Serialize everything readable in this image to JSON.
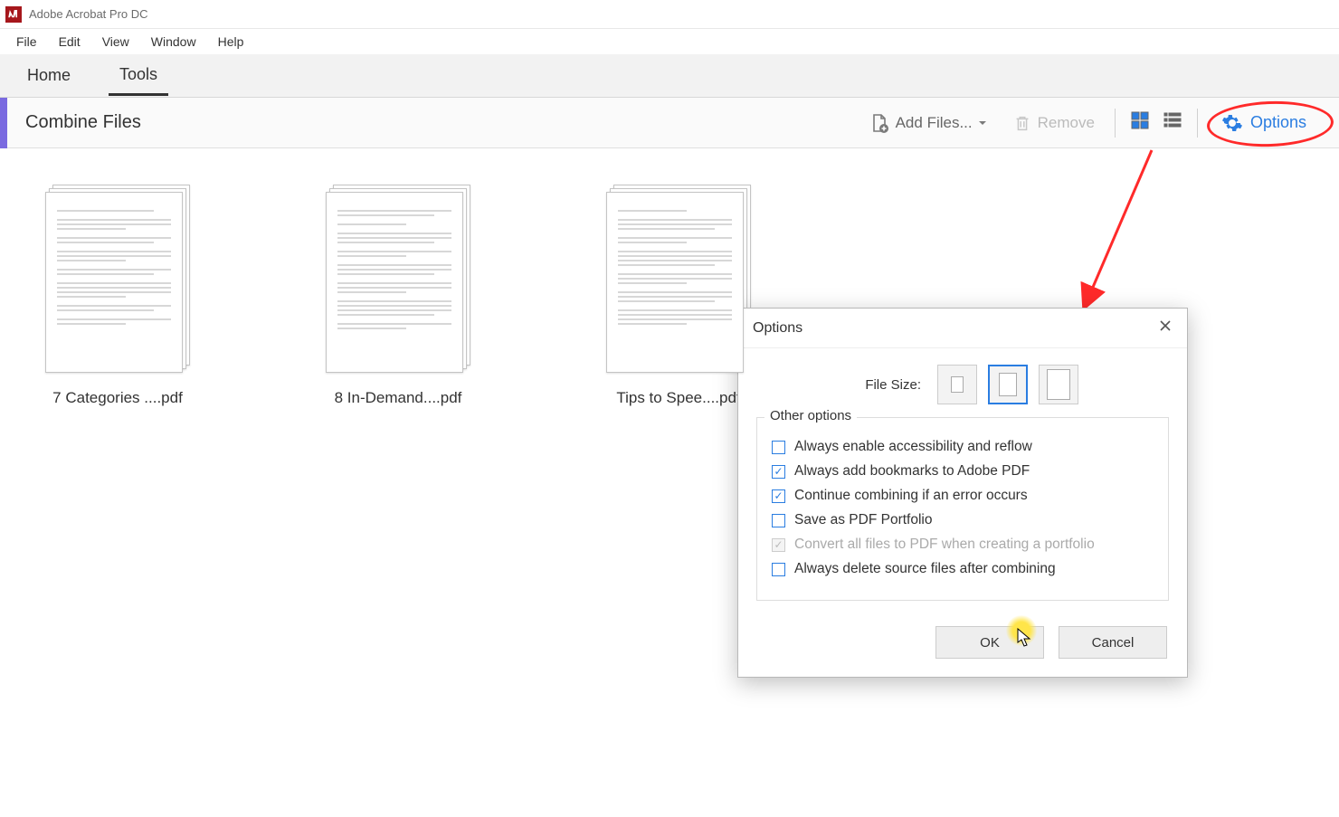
{
  "app": {
    "title": "Adobe Acrobat Pro DC"
  },
  "menu": {
    "file": "File",
    "edit": "Edit",
    "view": "View",
    "window": "Window",
    "help": "Help"
  },
  "tabs": {
    "home": "Home",
    "tools": "Tools"
  },
  "toolbar": {
    "page_title": "Combine Files",
    "add_files": "Add Files...",
    "remove": "Remove",
    "options": "Options"
  },
  "thumbs": [
    {
      "label": "7 Categories ....pdf"
    },
    {
      "label": "8 In-Demand....pdf"
    },
    {
      "label": "Tips to Spee....pdf"
    }
  ],
  "dialog": {
    "title": "Options",
    "file_size_label": "File Size:",
    "fieldset_legend": "Other options",
    "checks": [
      {
        "label": "Always enable accessibility and reflow",
        "checked": false,
        "disabled": false
      },
      {
        "label": "Always add bookmarks to Adobe PDF",
        "checked": true,
        "disabled": false
      },
      {
        "label": "Continue combining if an error occurs",
        "checked": true,
        "disabled": false
      },
      {
        "label": "Save as PDF Portfolio",
        "checked": false,
        "disabled": false
      },
      {
        "label": "Convert all files to PDF when creating a portfolio",
        "checked": true,
        "disabled": true
      },
      {
        "label": "Always delete source files after combining",
        "checked": false,
        "disabled": false
      }
    ],
    "ok": "OK",
    "cancel": "Cancel"
  }
}
